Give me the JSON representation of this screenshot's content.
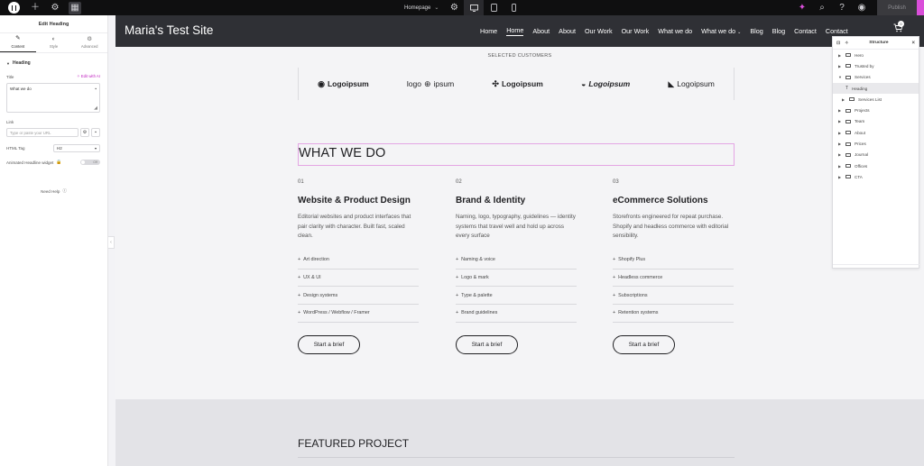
{
  "topbar": {
    "page_name": "Homepage",
    "publish_label": "Publish"
  },
  "panel": {
    "title": "Edit Heading",
    "tabs": [
      {
        "label": "Content"
      },
      {
        "label": "Style"
      },
      {
        "label": "Advanced"
      }
    ],
    "section": "Heading",
    "title_label": "Title",
    "edit_ai": "Edit with AI",
    "title_value": "What we do",
    "link_label": "Link",
    "link_placeholder": "Type or paste your URL",
    "html_tag_label": "HTML Tag",
    "html_tag_value": "H2",
    "animated_label": "Animated Headline widget",
    "toggle_label": "Off",
    "need_help": "Need Help"
  },
  "site": {
    "title": "Maria's Test Site",
    "nav": [
      "Home",
      "Home",
      "About",
      "About",
      "Our Work",
      "Our Work",
      "What we do",
      "What we do",
      "Blog",
      "Blog",
      "Contact",
      "Contact"
    ],
    "cart_count": "0",
    "customers_label": "SELECTED CUSTOMERS",
    "logos": [
      "Logoipsum",
      "logo",
      "ipsum",
      "Logoipsum",
      "Logoipsum",
      "Logoipsum"
    ],
    "section_title": "WHAT WE DO",
    "columns": [
      {
        "num": "01",
        "title": "Website & Product Design",
        "desc": "Editorial websites and product interfaces that pair clarity with character. Built fast, scaled clean.",
        "items": [
          "Art direction",
          "UX & UI",
          "Design systems",
          "WordPress / Webflow / Framer"
        ],
        "button": "Start a brief"
      },
      {
        "num": "02",
        "title": "Brand & Identity",
        "desc": "Naming, logo, typography, guidelines — identity systems that travel well and hold up across every surface",
        "items": [
          "Naming & voice",
          "Logo & mark",
          "Type & palette",
          "Brand guidelines"
        ],
        "button": "Start a brief"
      },
      {
        "num": "03",
        "title": "eCommerce Solutions",
        "desc": "Storefronts engineered for repeat purchase. Shopify and headless commerce with editorial sensibility.",
        "items": [
          "Shopify Plus",
          "Headless commerce",
          "Subscriptions",
          "Retention systems"
        ],
        "button": "Start a brief"
      }
    ],
    "featured_title": "FEATURED PROJECT"
  },
  "structure": {
    "title": "Structure",
    "items": [
      "Hero",
      "Trusted by",
      "Services",
      "Heading",
      "Services List",
      "Projects",
      "Team",
      "About",
      "Prices",
      "Journal",
      "Offices",
      "CTA"
    ]
  },
  "colors": {
    "accent": "#c226c2",
    "header_bg": "#2f3035",
    "topbar_bg": "#0f0f10"
  }
}
